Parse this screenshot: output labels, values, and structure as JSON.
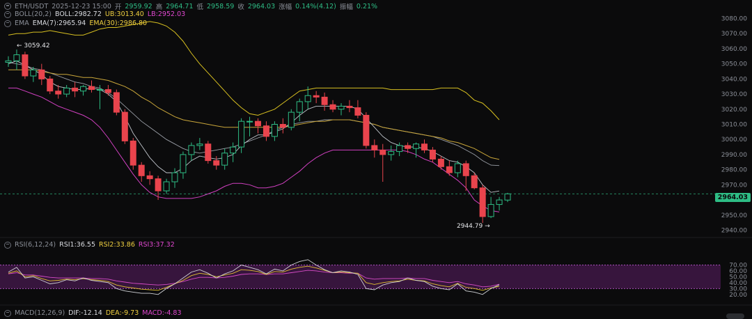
{
  "header": {
    "pair": "ETH/USDT",
    "datetime": "2025-12-23 15:00",
    "open_label": "开",
    "open": "2959.92",
    "high_label": "高",
    "high": "2964.71",
    "low_label": "低",
    "low": "2958.59",
    "close_label": "收",
    "close": "2964.03",
    "change_label": "涨幅",
    "change": "0.14%(4.12)",
    "amp_label": "振幅",
    "amp": "0.21%"
  },
  "boll": {
    "name": "BOLL(20,2)",
    "mid": "BOLL:2982.72",
    "ub": "UB:3013.40",
    "lb": "LB:2952.03"
  },
  "ema": {
    "name": "EMA",
    "ema7": "EMA(7):2965.94",
    "ema30": "EMA(30):2986.80"
  },
  "rsi": {
    "name": "RSI(6,12,24)",
    "r1": "RSI1:36.55",
    "r2": "RSI2:33.86",
    "r3": "RSI3:37.32"
  },
  "macd": {
    "name": "MACD(12,26,9)",
    "dif": "DIF:-12.14",
    "dea": "DEA:-9.73",
    "macd": "MACD:-4.83"
  },
  "annotations": {
    "high": "3059.42",
    "low": "2944.79"
  },
  "last_price": "2964.03",
  "colors": {
    "up": "#2ebd85",
    "down": "#e9444d",
    "ub": "#d8c020",
    "lb": "#d040c0",
    "mid": "#c8c8c8",
    "rsi_band": "#3a1640"
  },
  "chart_data": {
    "type": "candlestick",
    "ylim": [
      2937,
      3083
    ],
    "y_ticks": [
      "3080.00",
      "3070.00",
      "3060.00",
      "3050.00",
      "3040.00",
      "3030.00",
      "3020.00",
      "3010.00",
      "3000.00",
      "2990.00",
      "2980.00",
      "2970.00",
      "2960.00",
      "2950.00",
      "2940.00"
    ],
    "candles": [
      [
        3051,
        3055,
        3048,
        3052
      ],
      [
        3052,
        3059.42,
        3046,
        3056
      ],
      [
        3056,
        3058,
        3040,
        3042
      ],
      [
        3042,
        3048,
        3038,
        3046
      ],
      [
        3046,
        3050,
        3036,
        3040
      ],
      [
        3040,
        3042,
        3030,
        3032
      ],
      [
        3032,
        3036,
        3027,
        3030
      ],
      [
        3030,
        3036,
        3028,
        3034
      ],
      [
        3034,
        3038,
        3028,
        3032
      ],
      [
        3032,
        3036,
        3029,
        3035
      ],
      [
        3035,
        3039,
        3031,
        3033
      ],
      [
        3033,
        3036,
        3020,
        3033
      ],
      [
        3033,
        3036,
        3029,
        3031
      ],
      [
        3031,
        3033,
        3016,
        3018
      ],
      [
        3018,
        3020,
        2997,
        2999
      ],
      [
        2999,
        3001,
        2980,
        2983
      ],
      [
        2983,
        2985,
        2972,
        2976
      ],
      [
        2976,
        2979,
        2970,
        2974
      ],
      [
        2974,
        2976,
        2960,
        2966
      ],
      [
        2966,
        2974,
        2964,
        2972
      ],
      [
        2972,
        2981,
        2968,
        2978
      ],
      [
        2978,
        2992,
        2974,
        2990
      ],
      [
        2990,
        2998,
        2986,
        2996
      ],
      [
        2996,
        3001,
        2993,
        2997
      ],
      [
        2997,
        2999,
        2984,
        2986
      ],
      [
        2986,
        2989,
        2980,
        2983
      ],
      [
        2983,
        2994,
        2980,
        2991
      ],
      [
        2991,
        2998,
        2985,
        2995
      ],
      [
        2995,
        3014,
        2991,
        3012
      ],
      [
        3012,
        3015,
        3002,
        3012
      ],
      [
        3012,
        3014,
        3004,
        3009
      ],
      [
        3009,
        3012,
        2999,
        3002
      ],
      [
        3002,
        3012,
        2999,
        3010
      ],
      [
        3010,
        3014,
        3004,
        3008
      ],
      [
        3008,
        3020,
        3006,
        3018
      ],
      [
        3018,
        3027,
        3012,
        3025
      ],
      [
        3025,
        3035,
        3020,
        3029
      ],
      [
        3029,
        3032,
        3024,
        3028
      ],
      [
        3028,
        3031,
        3019,
        3023
      ],
      [
        3023,
        3026,
        3018,
        3020
      ],
      [
        3020,
        3024,
        3016,
        3022
      ],
      [
        3022,
        3026,
        3018,
        3021
      ],
      [
        3021,
        3026,
        3014,
        3016
      ],
      [
        3016,
        3018,
        2994,
        2996
      ],
      [
        2996,
        3000,
        2988,
        2993
      ],
      [
        2993,
        2997,
        2972,
        2990
      ],
      [
        2990,
        2996,
        2986,
        2992
      ],
      [
        2992,
        2998,
        2989,
        2996
      ],
      [
        2996,
        2998,
        2991,
        2994
      ],
      [
        2994,
        2998,
        2988,
        2997
      ],
      [
        2997,
        3000,
        2991,
        2993
      ],
      [
        2993,
        2995,
        2985,
        2987
      ],
      [
        2987,
        2989,
        2980,
        2982
      ],
      [
        2982,
        2986,
        2976,
        2978
      ],
      [
        2978,
        2986,
        2975,
        2984
      ],
      [
        2984,
        2986,
        2966,
        2976
      ],
      [
        2976,
        2978,
        2967,
        2968
      ],
      [
        2968,
        2970,
        2944.79,
        2949
      ],
      [
        2949,
        2962,
        2948,
        2957
      ],
      [
        2957,
        2962,
        2953,
        2960
      ],
      [
        2959.92,
        2964.71,
        2958.59,
        2964.03
      ]
    ],
    "boll_ub": [
      3069,
      3070,
      3070,
      3071,
      3071,
      3072,
      3071,
      3070,
      3069,
      3069,
      3071,
      3073,
      3074,
      3074,
      3075,
      3076,
      3077,
      3078,
      3077,
      3075,
      3071,
      3065,
      3057,
      3050,
      3044,
      3038,
      3032,
      3026,
      3021,
      3017,
      3016,
      3018,
      3020,
      3024,
      3028,
      3032,
      3033,
      3034,
      3034,
      3034,
      3034,
      3034,
      3034,
      3034,
      3034,
      3034,
      3033,
      3033,
      3033,
      3033,
      3033,
      3033,
      3034,
      3034,
      3034,
      3031,
      3026,
      3024,
      3019,
      3013
    ],
    "boll_mid": [
      3051,
      3050,
      3049,
      3047,
      3046,
      3044,
      3042,
      3040,
      3038,
      3037,
      3035,
      3034,
      3031,
      3027,
      3022,
      3017,
      3012,
      3008,
      3004,
      3000,
      2997,
      2994,
      2992,
      2991,
      2992,
      2993,
      2994,
      2995,
      2997,
      2999,
      3001,
      3003,
      3006,
      3008,
      3010,
      3011,
      3012,
      3012,
      3013,
      3013,
      3013,
      3013,
      3012,
      3011,
      3010,
      3008,
      3007,
      3006,
      3005,
      3004,
      3003,
      3002,
      3000,
      2998,
      2996,
      2993,
      2990,
      2986,
      2983,
      2982.72
    ],
    "boll_lb": [
      3034,
      3034,
      3032,
      3030,
      3028,
      3025,
      3022,
      3020,
      3018,
      3016,
      3013,
      3008,
      3001,
      2993,
      2985,
      2977,
      2970,
      2965,
      2962,
      2961,
      2961,
      2961,
      2961,
      2962,
      2964,
      2966,
      2969,
      2971,
      2971,
      2970,
      2968,
      2968,
      2969,
      2971,
      2975,
      2979,
      2984,
      2988,
      2991,
      2993,
      2993,
      2993,
      2993,
      2993,
      2993,
      2993,
      2993,
      2993,
      2992,
      2990,
      2987,
      2985,
      2981,
      2977,
      2973,
      2968,
      2960,
      2956,
      2953,
      2952.03
    ],
    "ema7": [
      3050,
      3052,
      3049,
      3046,
      3043,
      3038,
      3035,
      3034,
      3033,
      3033,
      3034,
      3033,
      3030,
      3025,
      3015,
      3004,
      2996,
      2988,
      2982,
      2978,
      2978,
      2981,
      2986,
      2989,
      2988,
      2987,
      2988,
      2990,
      2996,
      3000,
      3003,
      3003,
      3005,
      3007,
      3011,
      3016,
      3020,
      3022,
      3022,
      3022,
      3022,
      3022,
      3020,
      3014,
      3008,
      3002,
      2998,
      2996,
      2995,
      2995,
      2994,
      2992,
      2989,
      2986,
      2985,
      2982,
      2978,
      2970,
      2965,
      2965.94
    ],
    "ema30": [
      3046,
      3046,
      3046,
      3046,
      3045,
      3044,
      3043,
      3043,
      3042,
      3041,
      3041,
      3040,
      3039,
      3037,
      3035,
      3032,
      3028,
      3025,
      3021,
      3018,
      3015,
      3013,
      3012,
      3011,
      3010,
      3009,
      3008,
      3008,
      3008,
      3008,
      3008,
      3008,
      3008,
      3008,
      3009,
      3010,
      3011,
      3012,
      3012,
      3013,
      3013,
      3013,
      3012,
      3011,
      3010,
      3008,
      3007,
      3006,
      3005,
      3004,
      3003,
      3002,
      3001,
      2999,
      2998,
      2996,
      2994,
      2991,
      2988,
      2986.8
    ],
    "rsi_ticks": [
      "70.00",
      "60.00",
      "50.00",
      "40.00",
      "30.00",
      "20.00"
    ],
    "rsi_ylim": [
      15,
      80
    ],
    "rsi_band": [
      30,
      70
    ],
    "rsi1": [
      58,
      66,
      48,
      50,
      44,
      38,
      40,
      45,
      43,
      48,
      44,
      42,
      40,
      30,
      26,
      24,
      22,
      22,
      20,
      30,
      38,
      48,
      58,
      62,
      56,
      48,
      55,
      60,
      70,
      66,
      62,
      55,
      63,
      60,
      70,
      76,
      79,
      70,
      62,
      57,
      60,
      58,
      54,
      30,
      28,
      36,
      40,
      42,
      48,
      44,
      42,
      34,
      30,
      28,
      38,
      26,
      24,
      20,
      30,
      36.55
    ],
    "rsi2": [
      56,
      60,
      50,
      52,
      47,
      43,
      44,
      46,
      45,
      47,
      45,
      44,
      42,
      36,
      33,
      31,
      29,
      28,
      27,
      32,
      38,
      44,
      52,
      56,
      54,
      50,
      53,
      56,
      62,
      61,
      59,
      54,
      59,
      58,
      63,
      66,
      68,
      65,
      61,
      57,
      58,
      57,
      56,
      40,
      37,
      40,
      42,
      43,
      46,
      44,
      43,
      38,
      35,
      33,
      39,
      32,
      30,
      27,
      31,
      33.86
    ],
    "rsi3": [
      55,
      57,
      53,
      53,
      51,
      49,
      48,
      48,
      48,
      48,
      47,
      47,
      46,
      43,
      41,
      39,
      38,
      37,
      36,
      37,
      39,
      42,
      46,
      49,
      49,
      48,
      49,
      51,
      54,
      55,
      55,
      54,
      55,
      55,
      57,
      59,
      61,
      60,
      58,
      57,
      57,
      56,
      56,
      48,
      46,
      47,
      47,
      47,
      48,
      47,
      47,
      44,
      42,
      40,
      42,
      38,
      36,
      33,
      34,
      37.32
    ]
  }
}
